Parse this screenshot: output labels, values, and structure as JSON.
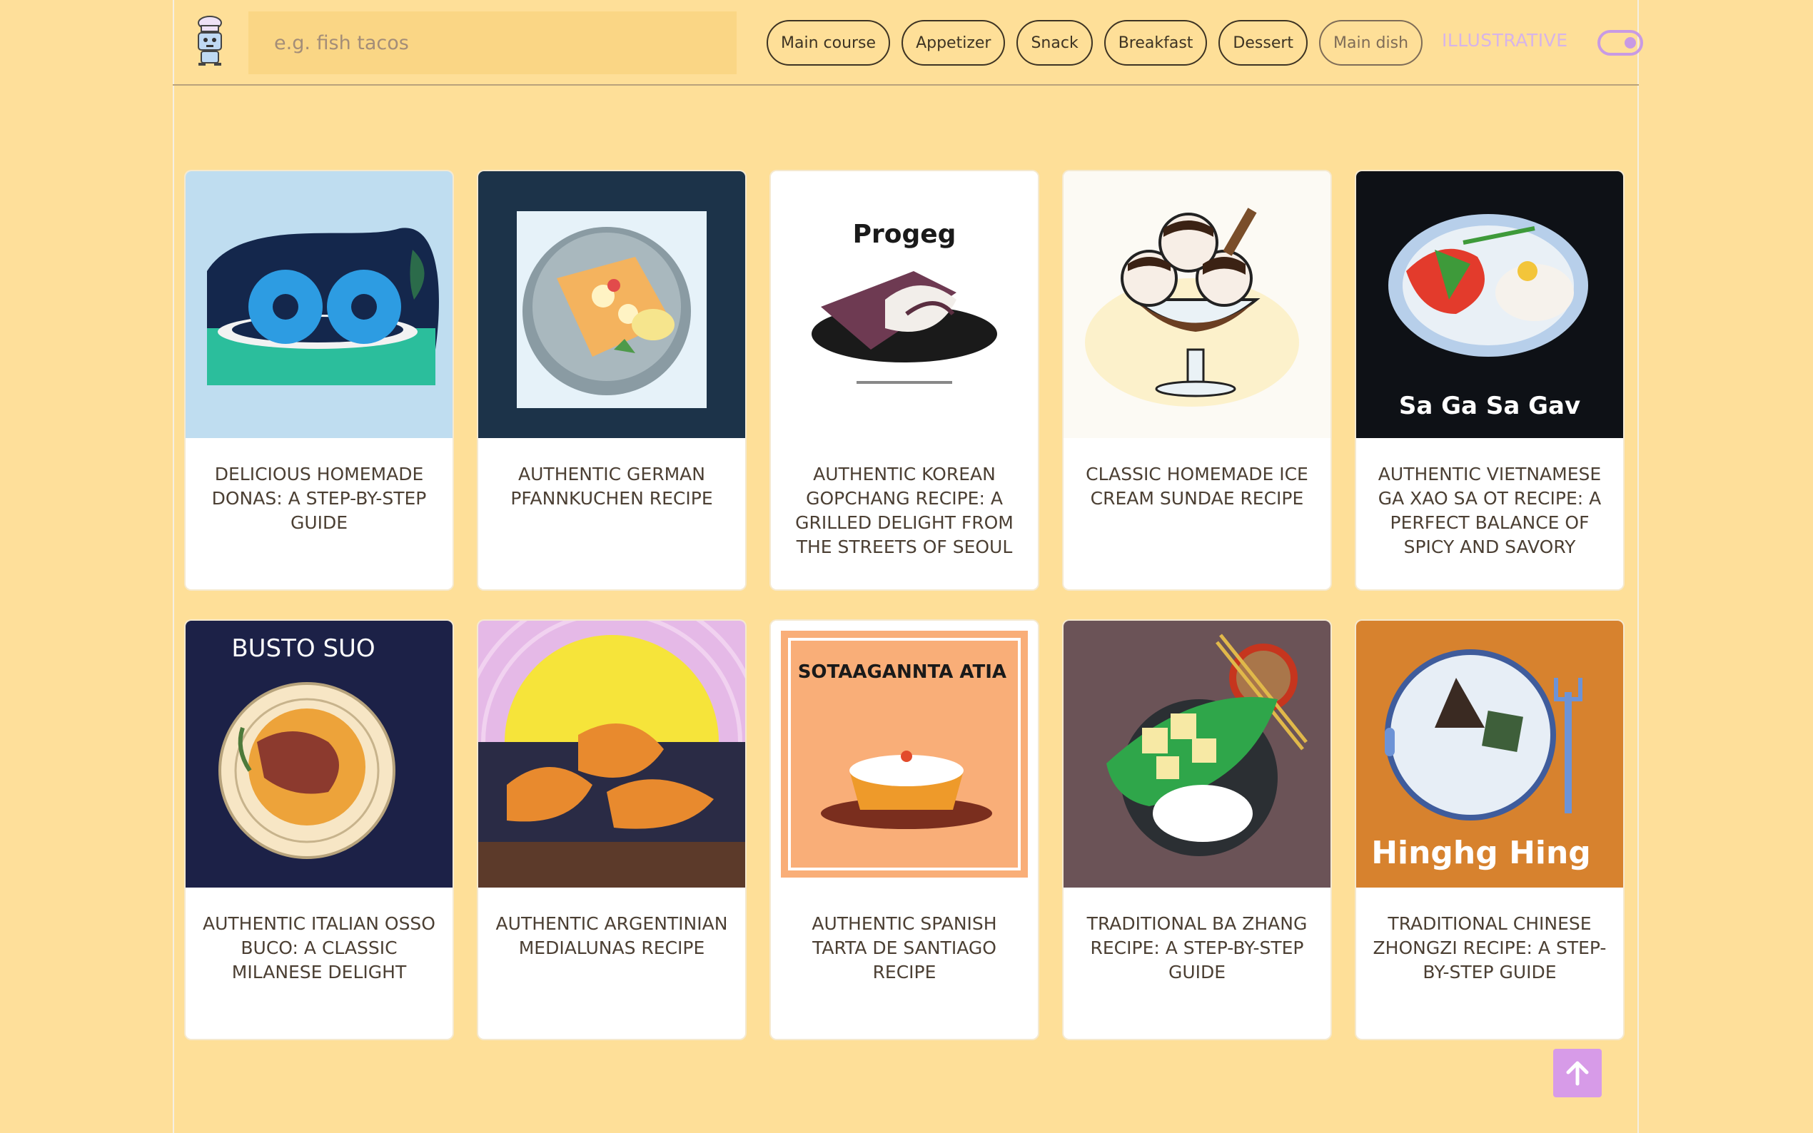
{
  "header": {
    "search_placeholder": "e.g. fish tacos",
    "chips": [
      "Main course",
      "Appetizer",
      "Snack",
      "Breakfast",
      "Dessert",
      "Main dish"
    ],
    "toggle_label": "ILLUSTRATIVE"
  },
  "recipes": [
    {
      "title": "DELICIOUS HOMEMADE DONAS: A STEP-BY-STEP GUIDE"
    },
    {
      "title": "AUTHENTIC GERMAN PFANNKUCHEN RECIPE"
    },
    {
      "title": "AUTHENTIC KOREAN GOPCHANG RECIPE: A GRILLED DELIGHT FROM THE STREETS OF SEOUL",
      "image_text": "Progeg"
    },
    {
      "title": "CLASSIC HOMEMADE ICE CREAM SUNDAE RECIPE"
    },
    {
      "title": "AUTHENTIC VIETNAMESE GA XAO SA OT RECIPE: A PERFECT BALANCE OF SPICY AND SAVORY",
      "image_text": "Sa Ga Sa Gav"
    },
    {
      "title": "AUTHENTIC ITALIAN OSSO BUCO: A CLASSIC MILANESE DELIGHT",
      "image_text": "BUSTO SUO"
    },
    {
      "title": "AUTHENTIC ARGENTINIAN MEDIALUNAS RECIPE"
    },
    {
      "title": "AUTHENTIC SPANISH TARTA DE SANTIAGO RECIPE",
      "image_text": "SOTAAGANNTA ATIA"
    },
    {
      "title": "TRADITIONAL BA ZHANG RECIPE: A STEP-BY-STEP GUIDE"
    },
    {
      "title": "TRADITIONAL CHINESE ZHONGZI RECIPE: A STEP-BY-STEP GUIDE",
      "image_text": "Hinghg Hing"
    }
  ],
  "colors": {
    "background": "#FEDF98",
    "accent": "#D79BE8",
    "text": "#4B3F33"
  },
  "icons": {
    "logo": "chef-robot-icon",
    "scroll_top": "arrow-up-icon"
  }
}
